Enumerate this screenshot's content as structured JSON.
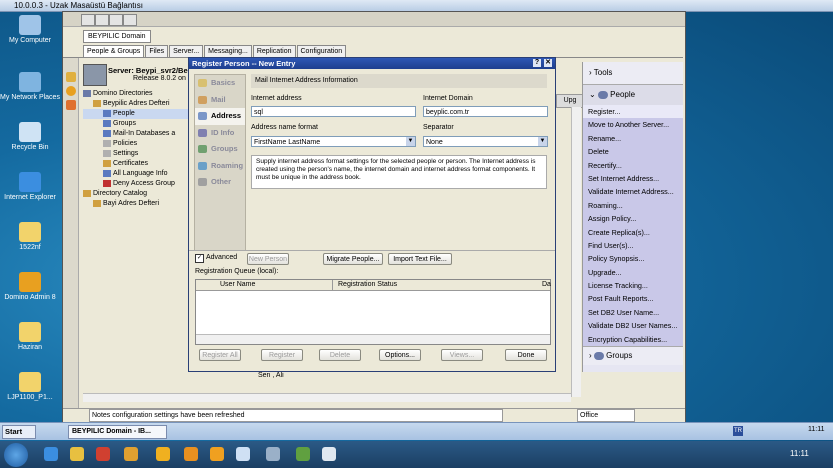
{
  "rdp": {
    "title": "10.0.0.3 - Uzak Masaüstü Bağlantısı"
  },
  "desktop_icons": [
    {
      "label": "My Computer",
      "color": "#9fc4e8"
    },
    {
      "label": "My Network Places",
      "color": "#7fb4e0"
    },
    {
      "label": "Recycle Bin",
      "color": "#cfe3f4"
    },
    {
      "label": "Internet Explorer",
      "color": "#3b8ee0"
    },
    {
      "label": "1522nf",
      "color": "#f2d36b"
    },
    {
      "label": "Domino Admin 8",
      "color": "#e8a020"
    },
    {
      "label": "Haziran",
      "color": "#f2d36b"
    },
    {
      "label": "LJP1100_P1...",
      "color": "#f2d36b"
    }
  ],
  "admin": {
    "domain_tab": "BEYPILIC Domain",
    "tabs": [
      "People & Groups",
      "Files",
      "Server...",
      "Messaging...",
      "Replication",
      "Configuration"
    ],
    "server_label": "Server: Beypi_svr2/Be",
    "release": "Release 8.0.2 on W",
    "tree": [
      "Domino Directories",
      "Beypilic Adres Defteri",
      "People",
      "Groups",
      "Mail-In Databases a",
      "Policies",
      "Settings",
      "Certificates",
      "All Language Info",
      "Deny Access Group",
      "Directory Catalog",
      "Bayi Adres Defteri"
    ],
    "list_item": "Sen , Ali",
    "status": "Notes configuration settings have been refreshed",
    "status_right": "Office",
    "upg": "Upg"
  },
  "right_panel": {
    "tools": "Tools",
    "people": "People",
    "groups": "Groups",
    "actions": [
      "Register...",
      "Move to Another Server...",
      "Rename...",
      "Delete",
      "Recertify...",
      "Set Internet Address...",
      "Validate Internet Address...",
      "Roaming...",
      "Assign Policy...",
      "Create Replica(s)...",
      "Find User(s)...",
      "Policy Synopsis...",
      "Upgrade...",
      "License Tracking...",
      "Post Fault Reports...",
      "Set DB2 User Name...",
      "Validate DB2 User Names...",
      "Encryption Capabilities..."
    ]
  },
  "dialog": {
    "title": "Register Person -- New Entry",
    "nav": [
      "Basics",
      "Mail",
      "Address",
      "ID Info",
      "Groups",
      "Roaming",
      "Other"
    ],
    "section_title": "Mail Internet Address Information",
    "internet_address_label": "Internet address",
    "internet_address_value": "sql",
    "internet_domain_label": "Internet Domain",
    "internet_domain_value": "beyplic.com.tr",
    "format_label": "Address name format",
    "format_value": "FirstName LastName",
    "separator_label": "Separator",
    "separator_value": "None",
    "help_text": "Supply internet address format settings for the selected people or person. The Internet address is created using the person's name, the internet domain and internet address format components. It must be unique in the address book.",
    "advanced_label": "Advanced",
    "new_person": "New Person",
    "migrate_people": "Migrate People...",
    "import_text": "Import Text File...",
    "queue_label": "Registration Queue (local):",
    "col_user": "User Name",
    "col_status": "Registration Status",
    "col_da": "Da",
    "register_all": "Register All",
    "register": "Register",
    "delete": "Delete",
    "options": "Options...",
    "views": "Views...",
    "done": "Done"
  },
  "taskbar": {
    "start": "Start",
    "task": "BEYPILIC Domain - IB...",
    "lang": "TR",
    "clock": "11:11"
  }
}
